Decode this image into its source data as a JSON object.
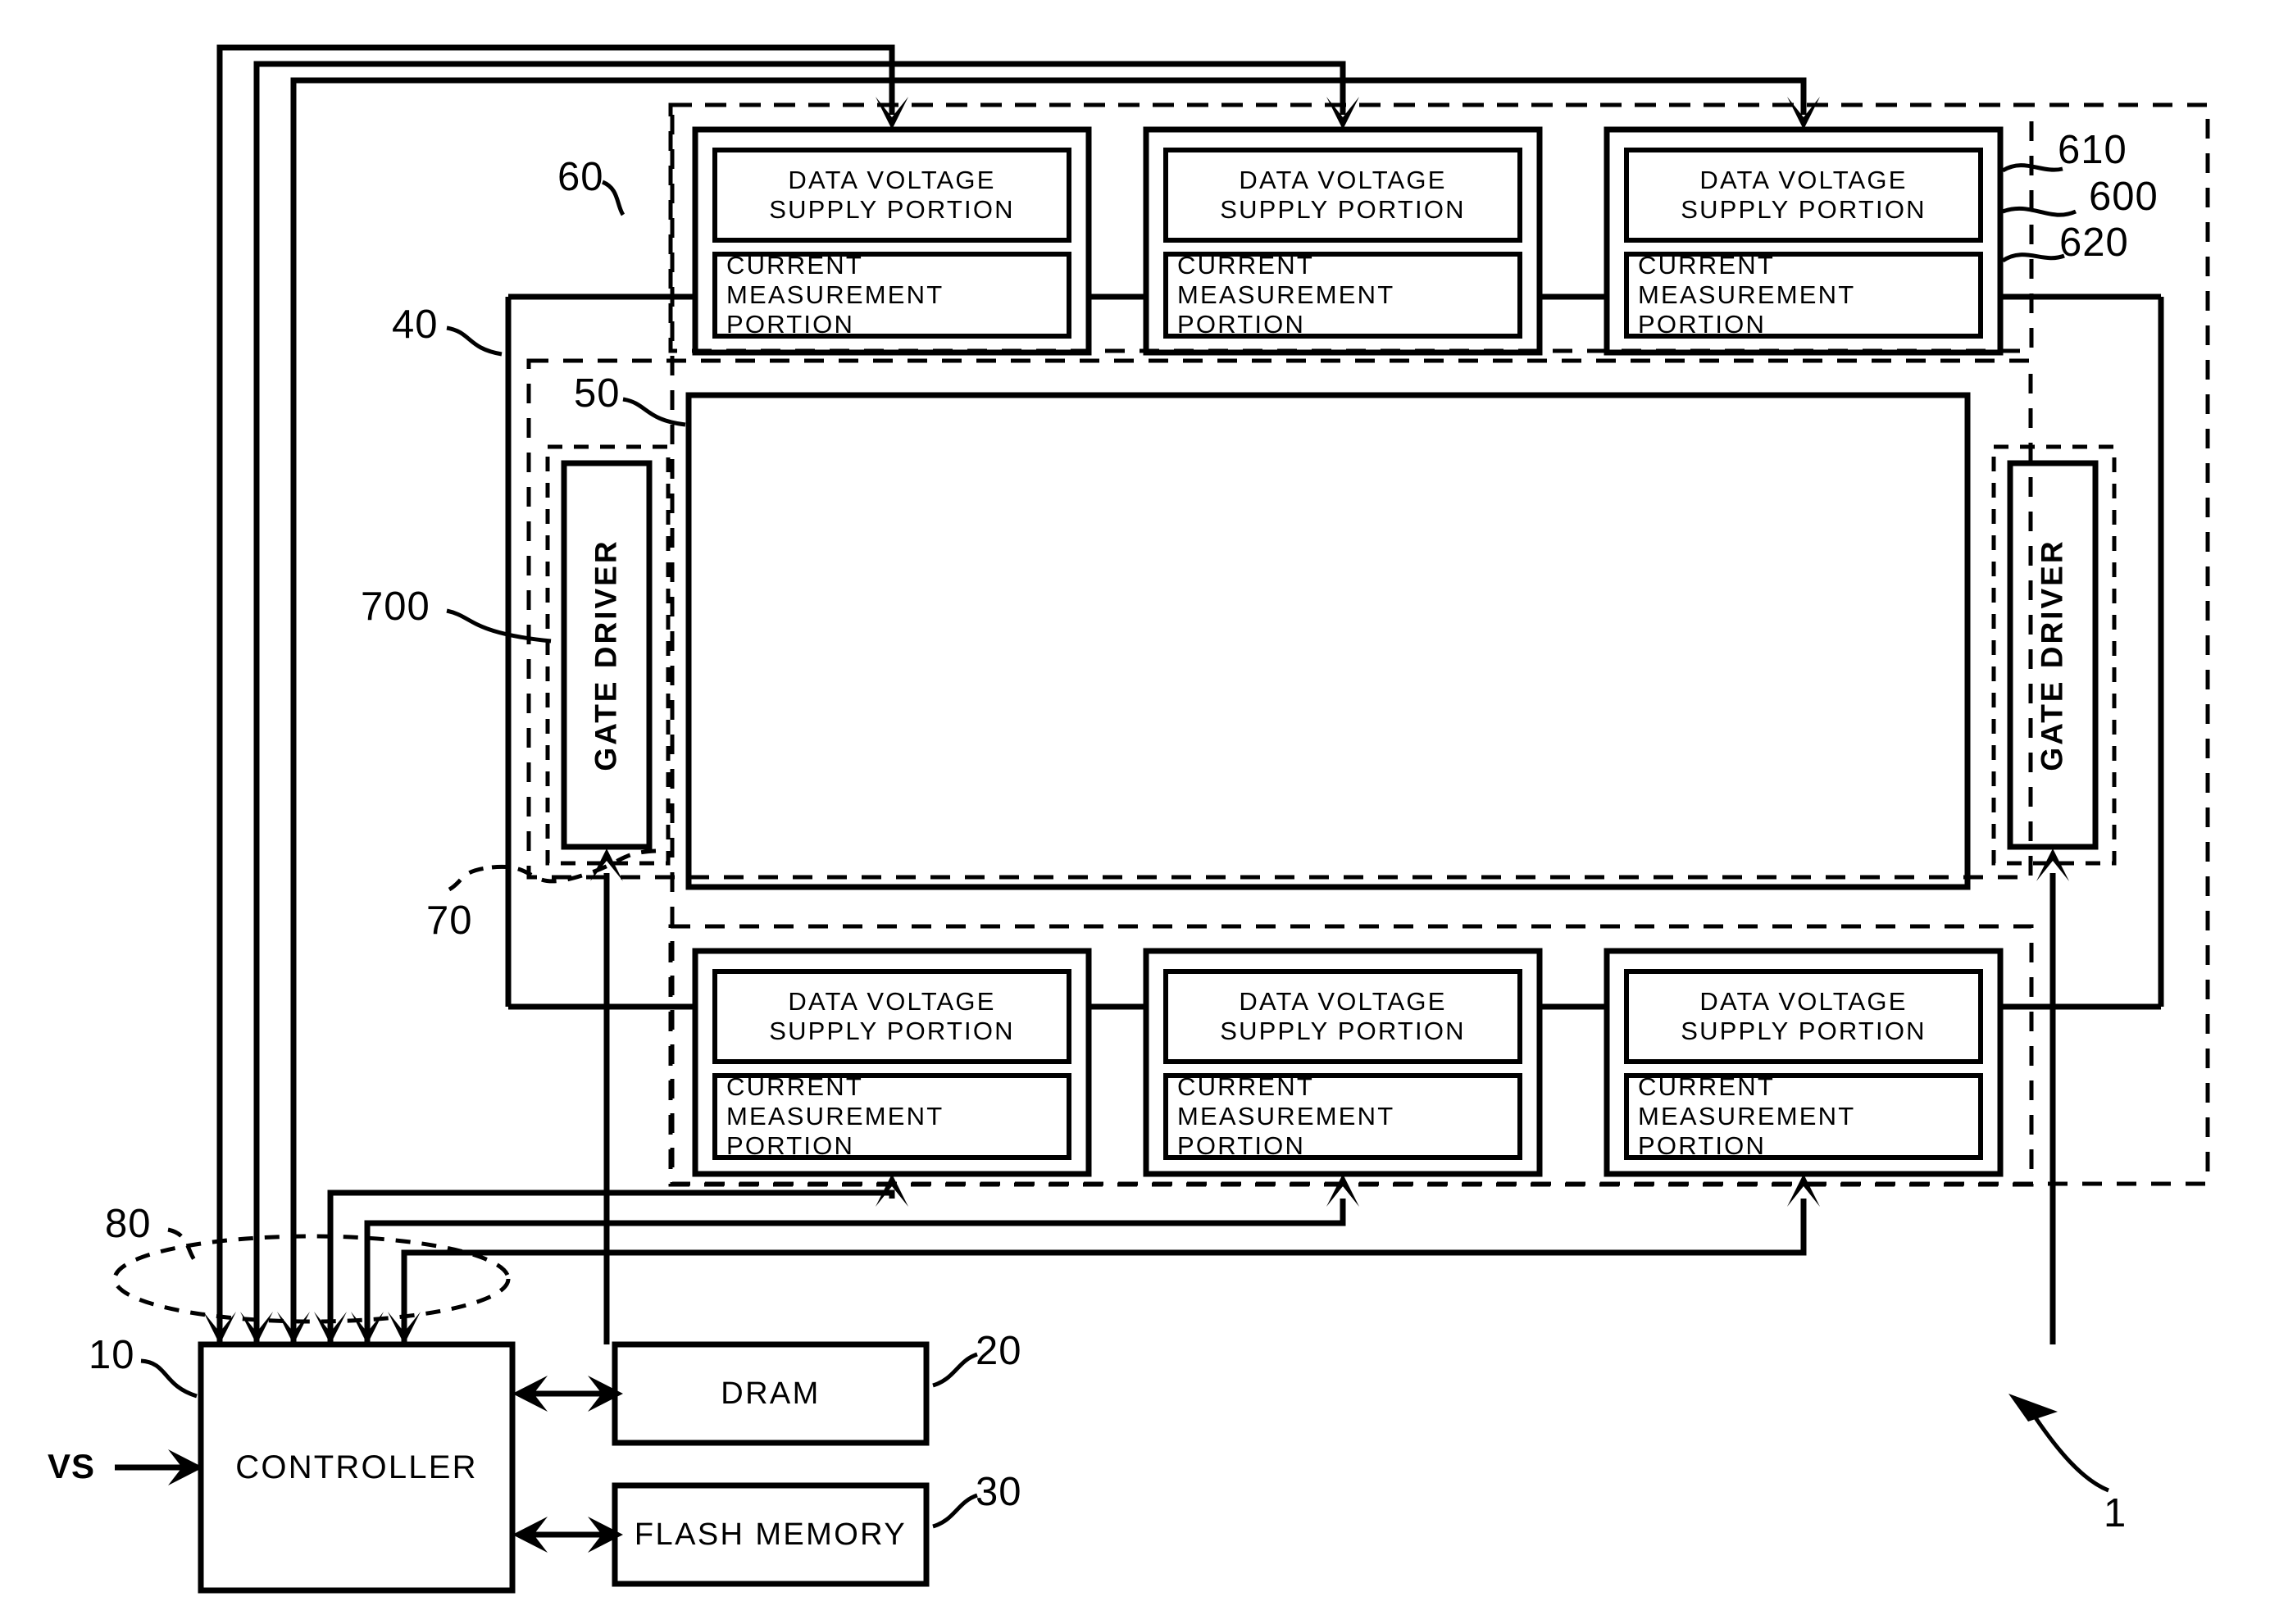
{
  "figure": {
    "title": "Display device block diagram",
    "overall_ref": "1"
  },
  "blocks": {
    "data_voltage_supply_label_line1": "DATA VOLTAGE",
    "data_voltage_supply_label_line2": "SUPPLY PORTION",
    "current_measurement_label_line1": "CURRENT",
    "current_measurement_label_line2": "MEASUREMENT PORTION",
    "gate_driver_label": "GATE DRIVER",
    "controller_label": "CONTROLLER",
    "dram_label": "DRAM",
    "flash_memory_label": "FLASH MEMORY"
  },
  "signals": {
    "vs_label": "VS"
  },
  "refs": {
    "source_driver_group_top": "60",
    "panel_module": "40",
    "display_panel": "50",
    "gate_driver_left": "700",
    "source_driver_group_bottom": "70",
    "controller_bus": "80",
    "controller": "10",
    "dram": "20",
    "flash_memory": "30",
    "data_voltage_supply_portion": "610",
    "source_driver_ic": "600",
    "current_measurement_portion": "620",
    "device": "1"
  },
  "driver_rows": {
    "top": [
      {
        "id": "top-0",
        "dvs_l1": "DATA VOLTAGE",
        "dvs_l2": "SUPPLY PORTION",
        "cmp_l1": "CURRENT",
        "cmp_l2": "MEASUREMENT PORTION"
      },
      {
        "id": "top-1",
        "dvs_l1": "DATA VOLTAGE",
        "dvs_l2": "SUPPLY PORTION",
        "cmp_l1": "CURRENT",
        "cmp_l2": "MEASUREMENT PORTION"
      },
      {
        "id": "top-2",
        "dvs_l1": "DATA VOLTAGE",
        "dvs_l2": "SUPPLY PORTION",
        "cmp_l1": "CURRENT",
        "cmp_l2": "MEASUREMENT PORTION"
      }
    ],
    "bottom": [
      {
        "id": "bot-0",
        "dvs_l1": "DATA VOLTAGE",
        "dvs_l2": "SUPPLY PORTION",
        "cmp_l1": "CURRENT",
        "cmp_l2": "MEASUREMENT PORTION"
      },
      {
        "id": "bot-1",
        "dvs_l1": "DATA VOLTAGE",
        "dvs_l2": "SUPPLY PORTION",
        "cmp_l1": "CURRENT",
        "cmp_l2": "MEASUREMENT PORTION"
      },
      {
        "id": "bot-2",
        "dvs_l1": "DATA VOLTAGE",
        "dvs_l2": "SUPPLY PORTION",
        "cmp_l1": "CURRENT",
        "cmp_l2": "MEASUREMENT PORTION"
      }
    ]
  },
  "gate_drivers": [
    {
      "id": "gate-left",
      "label": "GATE DRIVER"
    },
    {
      "id": "gate-right",
      "label": "GATE DRIVER"
    }
  ],
  "colors": {
    "line": "#000000",
    "background": "#ffffff"
  }
}
